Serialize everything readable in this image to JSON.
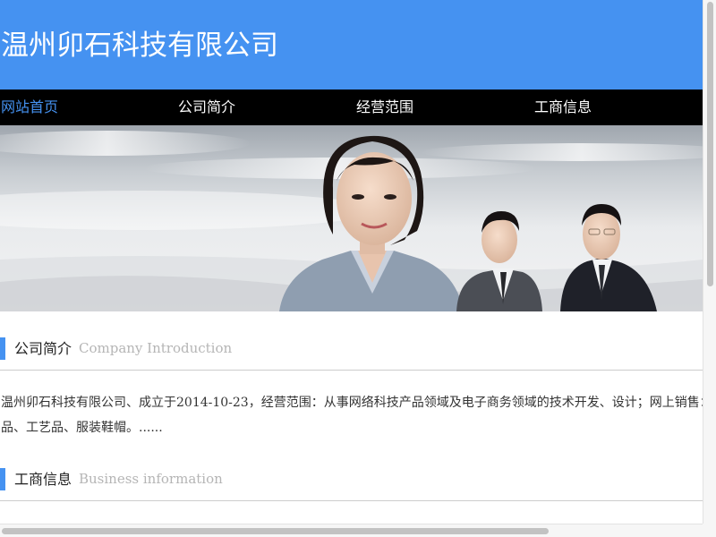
{
  "header": {
    "site_title": "温州卯石科技有限公司",
    "background_color": "#4592f1"
  },
  "nav": {
    "items": [
      {
        "label": "网站首页",
        "active": true
      },
      {
        "label": "公司简介",
        "active": false
      },
      {
        "label": "经营范围",
        "active": false
      },
      {
        "label": "工商信息",
        "active": false
      }
    ],
    "active_color": "#4592f1"
  },
  "banner": {
    "image": "business-team-photo"
  },
  "sections": {
    "intro": {
      "title": "公司简介",
      "subtitle": "Company Introduction",
      "text": "温州卯石科技有限公司、成立于2014-10-23，经营范围：从事网络科技产品领域及电子商务领域的技术开发、设计；网上销售：日用品、工艺品、服装鞋帽。......"
    },
    "business": {
      "title": "工商信息",
      "subtitle": "Business information"
    }
  }
}
